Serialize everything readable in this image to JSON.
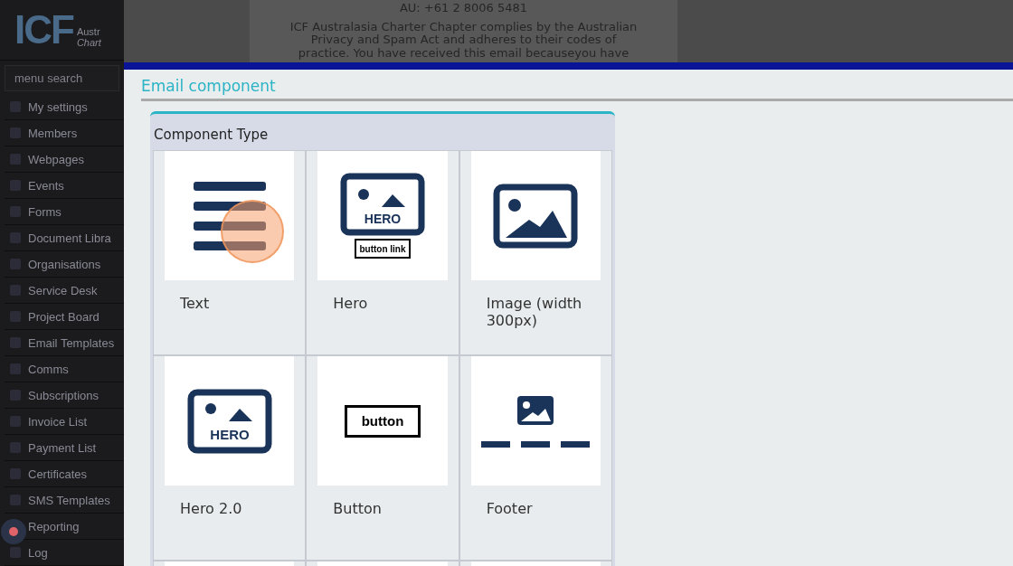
{
  "sidebar": {
    "logo": {
      "mark": "ICF",
      "line_1": "Austr",
      "line_2": "Chart"
    },
    "search": {
      "placeholder": "menu search"
    },
    "items": [
      {
        "label": "My settings"
      },
      {
        "label": "Members"
      },
      {
        "label": "Webpages"
      },
      {
        "label": "Events"
      },
      {
        "label": "Forms"
      },
      {
        "label": "Document Libra"
      },
      {
        "label": "Organisations"
      },
      {
        "label": "Service Desk"
      },
      {
        "label": "Project Board"
      },
      {
        "label": "Email Templates"
      },
      {
        "label": "Comms"
      },
      {
        "label": "Subscriptions"
      },
      {
        "label": "Invoice List"
      },
      {
        "label": "Payment List"
      },
      {
        "label": "Certificates"
      },
      {
        "label": "SMS Templates"
      },
      {
        "label": "Reporting"
      },
      {
        "label": "Log"
      }
    ]
  },
  "email_preview": {
    "phone": "AU: +61 2 8006 5481",
    "notice": "ICF Australasia Charter Chapter complies by the Australian Privacy and Spam Act and adheres to their codes of practice. You have received this email becauseyou have"
  },
  "dialog": {
    "title": "Email component",
    "section_title": "Component Type",
    "components": [
      {
        "kind": "text",
        "label": "Text"
      },
      {
        "kind": "hero",
        "label": "Hero",
        "badge": "HERO",
        "link": "button link"
      },
      {
        "kind": "image",
        "label": "Image (width 300px)"
      },
      {
        "kind": "hero2",
        "label": "Hero 2.0",
        "badge": "HERO"
      },
      {
        "kind": "button",
        "label": "Button",
        "caption": "button"
      },
      {
        "kind": "footer",
        "label": "Footer"
      },
      {
        "kind": "twin"
      },
      {
        "kind": "blank"
      },
      {
        "kind": "blank"
      }
    ]
  }
}
